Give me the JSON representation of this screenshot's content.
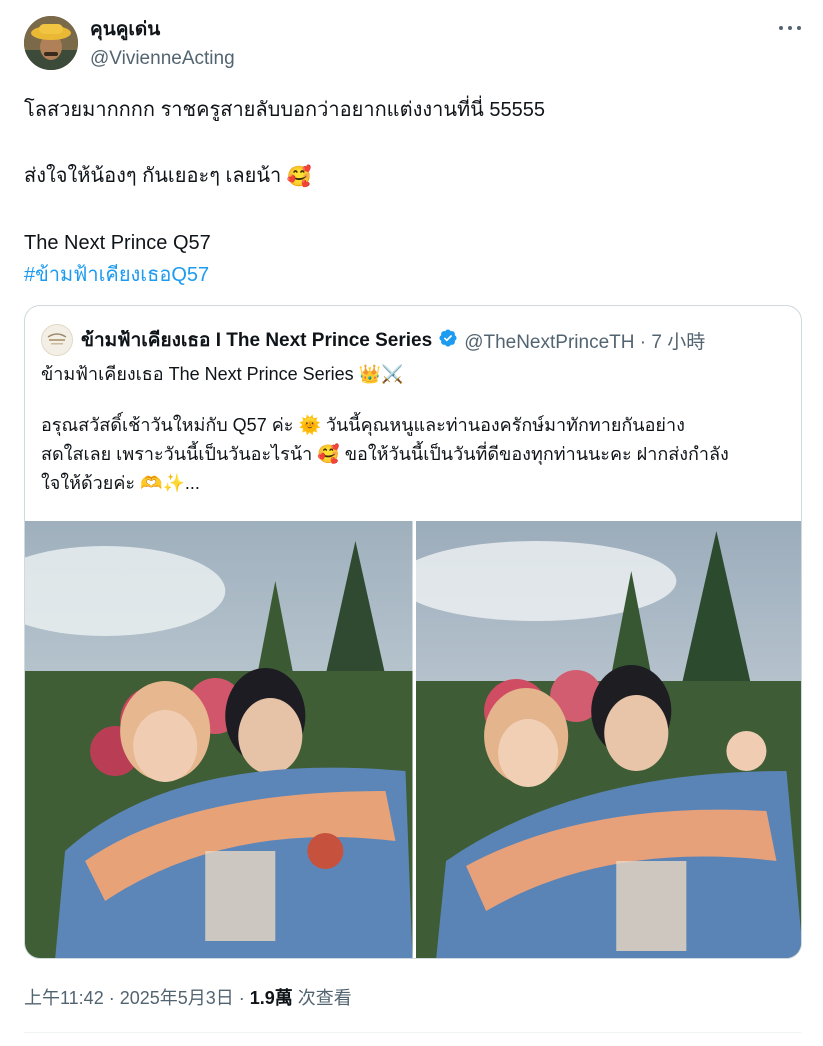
{
  "author": {
    "display_name": "คุนคูเด่น",
    "handle": "@VivienneActing"
  },
  "tweet": {
    "line1": "โลสวยมากกกก ราชครูสายลับบอกว่าอยากแต่งงานที่นี่  55555",
    "line2": "ส่งใจให้น้องๆ กันเยอะๆ เลยน้า",
    "line2_emoji": "🥰",
    "line3": "The Next Prince Q57",
    "hashtag": "#ข้ามฟ้าเคียงเธอQ57"
  },
  "quoted": {
    "name": "ข้ามฟ้าเคียงเธอ I The Next Prince Series",
    "handle_time": "@TheNextPrinceTH · 7 小時",
    "line1": "ข้ามฟ้าเคียงเธอ The Next Prince Series",
    "line1_emoji": "👑⚔️",
    "line2a": "อรุณสวัสดิ์เช้าวันใหม่กับ Q57 ค่ะ",
    "line2_emoji": "🌞",
    "line2b": "วันนี้คุณหนูและท่านองครักษ์มาทักทายกันอย่าง",
    "line3a": "สดใสเลย เพราะวันนี้เป็นวันอะไรน้า",
    "line3_emoji": "🥰",
    "line3b": "ขอให้วันนี้เป็นวันที่ดีของทุกท่านนะคะ ฝากส่งกำลัง",
    "line4a": "ใจให้ด้วยค่ะ",
    "line4_emoji": "🫶✨",
    "line4b": "..."
  },
  "meta": {
    "time": "上午11:42 · 2025年5月3日 · ",
    "views_count": "1.9萬",
    "views_label": " 次查看"
  },
  "colors": {
    "link": "#1d9bf0",
    "secondary_text": "#536471",
    "border": "#cfd9de"
  },
  "icons": [
    "more-icon",
    "verified-badge-icon"
  ]
}
